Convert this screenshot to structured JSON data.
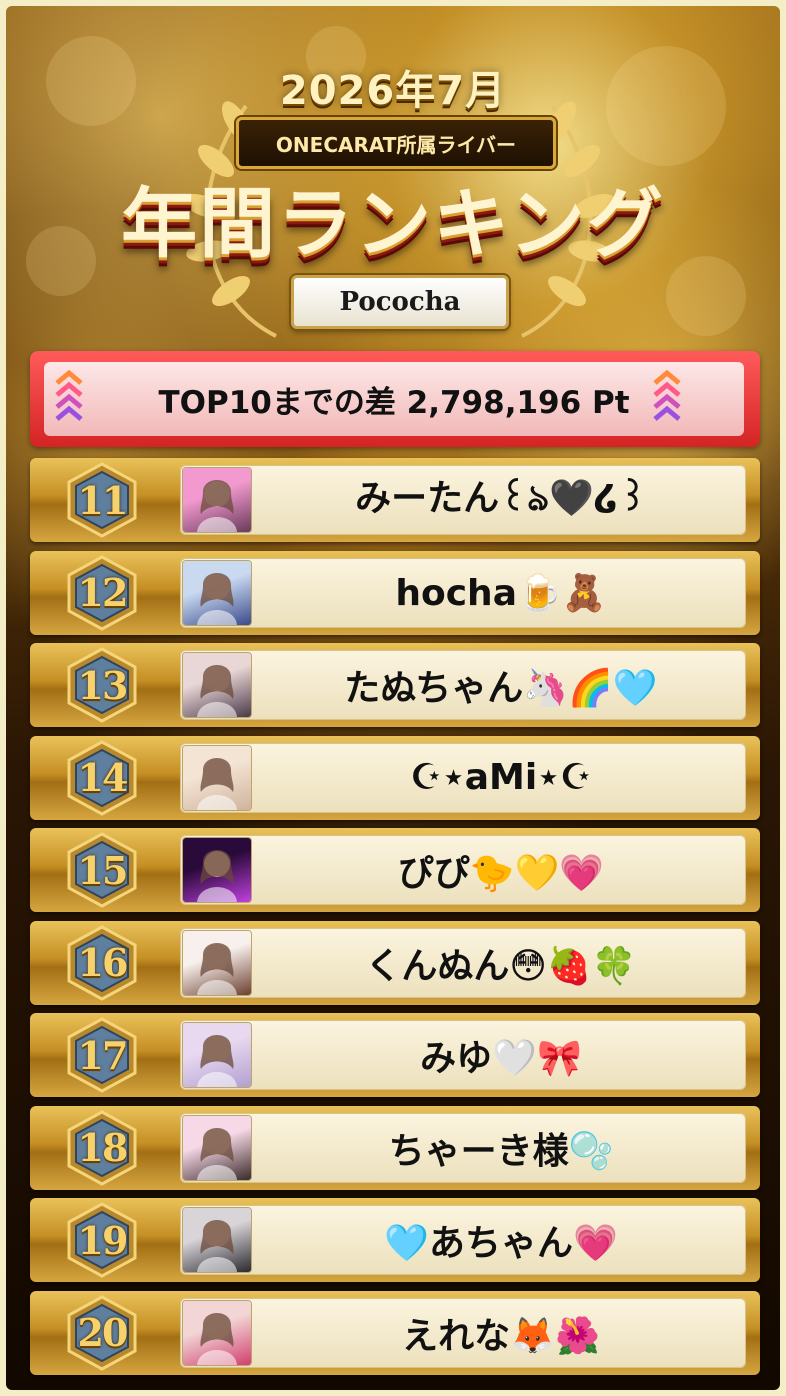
{
  "header": {
    "year_month": "2026年7月",
    "agency": "ONECARAT所属ライバー",
    "title": "年間ランキング",
    "platform": "Pococha"
  },
  "gap_banner": {
    "text": "TOP10までの差 2,798,196 Pt"
  },
  "colors": {
    "gold": "#c58f24",
    "banner_red": "#d42424",
    "panel_cream": "#fbf4df",
    "badge_blue": "#5f7f9e"
  },
  "rankings": [
    {
      "rank": "11",
      "name": "みーたん꒰ঌ🖤໒꒱",
      "thumb_colors": [
        "#f29ad0",
        "#6a3a5a"
      ]
    },
    {
      "rank": "12",
      "name": "hocha🍺🧸",
      "thumb_colors": [
        "#c9d9f0",
        "#3a4a8a"
      ]
    },
    {
      "rank": "13",
      "name": "たぬちゃん🦄🌈🩵",
      "thumb_colors": [
        "#e9d6d6",
        "#4a3a4a"
      ]
    },
    {
      "rank": "14",
      "name": "☪︎⋆aMi⋆☪︎",
      "thumb_colors": [
        "#f4e4d4",
        "#cfb49c"
      ]
    },
    {
      "rank": "15",
      "name": "ぴぴ🐤💛💗",
      "thumb_colors": [
        "#2a0a3a",
        "#c040e0"
      ]
    },
    {
      "rank": "16",
      "name": "くんぬん😳🍓🍀",
      "thumb_colors": [
        "#f8f0ec",
        "#6a4030"
      ]
    },
    {
      "rank": "17",
      "name": "みゆ🤍🎀",
      "thumb_colors": [
        "#e8d8f0",
        "#b0a0d0"
      ]
    },
    {
      "rank": "18",
      "name": "ちゃーき様🫧",
      "thumb_colors": [
        "#f6d8e6",
        "#3a2a2a"
      ]
    },
    {
      "rank": "19",
      "name": "🩵あちゃん💗",
      "thumb_colors": [
        "#d8d4d8",
        "#2a2a30"
      ]
    },
    {
      "rank": "20",
      "name": "えれな🦊🌺",
      "thumb_colors": [
        "#f2d6d6",
        "#d04070"
      ]
    }
  ]
}
